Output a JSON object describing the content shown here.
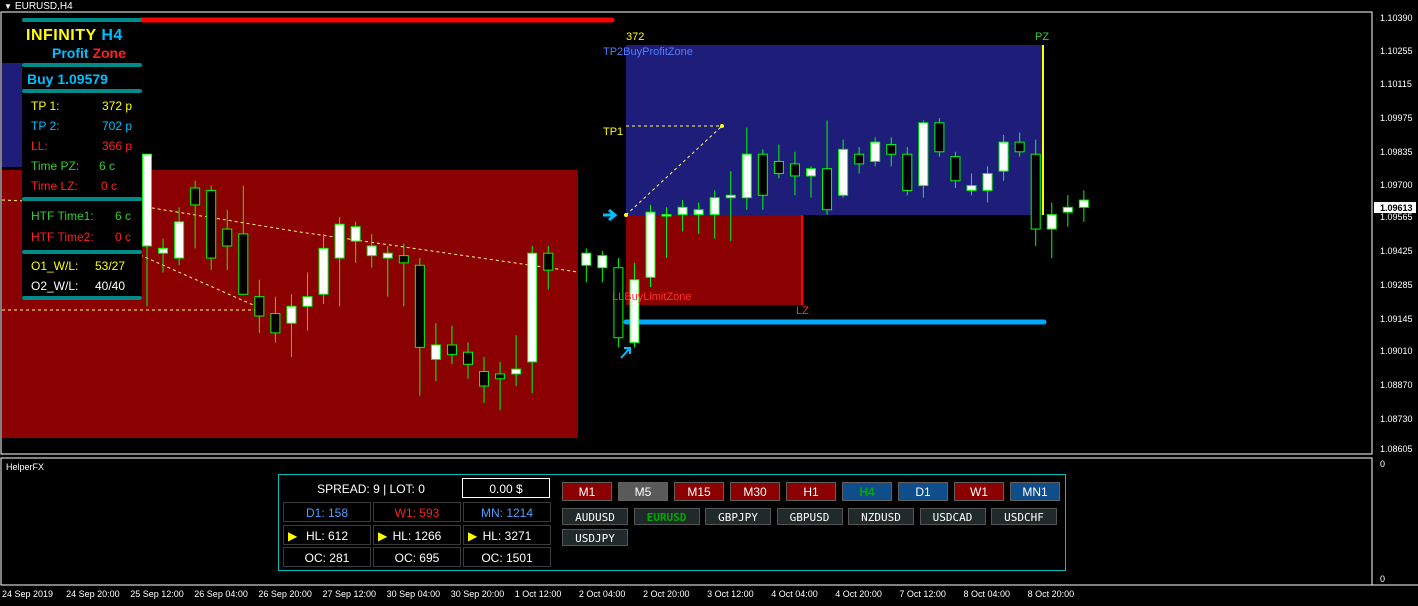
{
  "window": {
    "title": "EURUSD,H4"
  },
  "colors": {
    "bull_candle": "#ffffff",
    "candle_border": "#00ff00",
    "profit_zone": "#1e1e7a",
    "limit_zone": "#8b0000",
    "red_line": "#ff0000",
    "blue_line": "#00aaff"
  },
  "infinity_panel": {
    "logo_prefix": "INFINITY",
    "logo_timeframe": "H4",
    "logo_profit": "Profit",
    "logo_zone": "Zone",
    "signal": "Buy 1.09579",
    "rows": [
      {
        "label": "TP 1:",
        "value": "372 p",
        "color": "#ffff00"
      },
      {
        "label": "TP 2:",
        "value": "702 p",
        "color": "#00bfff"
      },
      {
        "label": "LL:",
        "value": "366 p",
        "color": "#ff2020"
      },
      {
        "label": "Time PZ:",
        "value": "6 c",
        "color": "#32cd32"
      },
      {
        "label": "Time LZ:",
        "value": "0 c",
        "color": "#ff2020"
      }
    ],
    "htf_rows": [
      {
        "label": "HTF Time1:",
        "value": "6 c",
        "color": "#32cd32"
      },
      {
        "label": "HTF Time2:",
        "value": "0 c",
        "color": "#ff2020"
      }
    ],
    "wl_rows": [
      {
        "label": "O1_W/L:",
        "value": "53/27",
        "color": "#ffff00"
      },
      {
        "label": "O2_W/L:",
        "value": "40/40",
        "color": "#ffffff"
      }
    ]
  },
  "annotations": {
    "tp1_label": "TP1",
    "tp1_points": "372",
    "tp2_zone": "TP2BuyProfitZone",
    "pz": "PZ",
    "ll_zone": "LLBuyLimitZone",
    "lz": "LZ"
  },
  "chart_data": {
    "type": "candlestick",
    "symbol": "EURUSD",
    "timeframe": "H4",
    "current_price": "1.09613",
    "y_ticks": [
      "1.10390",
      "1.10255",
      "1.10115",
      "1.09975",
      "1.09835",
      "1.09700",
      "1.09565",
      "1.09425",
      "1.09285",
      "1.09145",
      "1.09010",
      "1.08870",
      "1.08730",
      "1.08605"
    ],
    "ylim": [
      1.08605,
      1.1039
    ],
    "x_ticks": [
      "24 Sep 2019",
      "24 Sep 20:00",
      "25 Sep 12:00",
      "26 Sep 04:00",
      "26 Sep 20:00",
      "27 Sep 12:00",
      "30 Sep 04:00",
      "30 Sep 20:00",
      "1 Oct 12:00",
      "2 Oct 04:00",
      "2 Oct 20:00",
      "3 Oct 12:00",
      "4 Oct 04:00",
      "4 Oct 20:00",
      "7 Oct 12:00",
      "8 Oct 04:00",
      "8 Oct 20:00"
    ],
    "candles": [
      {
        "o": 1.0945,
        "h": 1.0982,
        "l": 1.092,
        "c": 1.0983
      },
      {
        "o": 1.0942,
        "h": 1.0948,
        "l": 1.0934,
        "c": 1.0944
      },
      {
        "o": 1.094,
        "h": 1.0961,
        "l": 1.0937,
        "c": 1.0955
      },
      {
        "o": 1.0969,
        "h": 1.0972,
        "l": 1.0944,
        "c": 1.0962
      },
      {
        "o": 1.0968,
        "h": 1.097,
        "l": 1.0935,
        "c": 1.094
      },
      {
        "o": 1.0952,
        "h": 1.096,
        "l": 1.0935,
        "c": 1.0945
      },
      {
        "o": 1.095,
        "h": 1.097,
        "l": 1.0927,
        "c": 1.0925
      },
      {
        "o": 1.0924,
        "h": 1.0931,
        "l": 1.0909,
        "c": 1.0916
      },
      {
        "o": 1.0917,
        "h": 1.0924,
        "l": 1.0905,
        "c": 1.0909
      },
      {
        "o": 1.0913,
        "h": 1.0925,
        "l": 1.0899,
        "c": 1.092
      },
      {
        "o": 1.092,
        "h": 1.0934,
        "l": 1.091,
        "c": 1.0924
      },
      {
        "o": 1.0925,
        "h": 1.095,
        "l": 1.0921,
        "c": 1.0944
      },
      {
        "o": 1.094,
        "h": 1.0957,
        "l": 1.092,
        "c": 1.0954
      },
      {
        "o": 1.0947,
        "h": 1.0955,
        "l": 1.0938,
        "c": 1.0953
      },
      {
        "o": 1.0941,
        "h": 1.095,
        "l": 1.0936,
        "c": 1.0945
      },
      {
        "o": 1.094,
        "h": 1.0945,
        "l": 1.0924,
        "c": 1.0942
      },
      {
        "o": 1.0941,
        "h": 1.0946,
        "l": 1.092,
        "c": 1.0938
      },
      {
        "o": 1.0937,
        "h": 1.094,
        "l": 1.0883,
        "c": 1.0903
      },
      {
        "o": 1.0898,
        "h": 1.0913,
        "l": 1.0889,
        "c": 1.0904
      },
      {
        "o": 1.0904,
        "h": 1.0912,
        "l": 1.0896,
        "c": 1.09
      },
      {
        "o": 1.0901,
        "h": 1.0905,
        "l": 1.089,
        "c": 1.0896
      },
      {
        "o": 1.0893,
        "h": 1.0899,
        "l": 1.088,
        "c": 1.0887
      },
      {
        "o": 1.0892,
        "h": 1.0897,
        "l": 1.0877,
        "c": 1.089
      },
      {
        "o": 1.0892,
        "h": 1.0908,
        "l": 1.0887,
        "c": 1.0894
      },
      {
        "o": 1.0897,
        "h": 1.0945,
        "l": 1.0884,
        "c": 1.0942
      },
      {
        "o": 1.0942,
        "h": 1.0945,
        "l": 1.0927,
        "c": 1.0935
      },
      {
        "o": 1.0937,
        "h": 1.0944,
        "l": 1.093,
        "c": 1.0942
      },
      {
        "o": 1.0936,
        "h": 1.0943,
        "l": 1.093,
        "c": 1.0941
      },
      {
        "o": 1.0936,
        "h": 1.094,
        "l": 1.0903,
        "c": 1.0907
      },
      {
        "o": 1.0905,
        "h": 1.0938,
        "l": 1.0903,
        "c": 1.0931
      },
      {
        "o": 1.0932,
        "h": 1.0962,
        "l": 1.0928,
        "c": 1.0959
      },
      {
        "o": 1.0958,
        "h": 1.0961,
        "l": 1.094,
        "c": 1.0958
      },
      {
        "o": 1.0958,
        "h": 1.0964,
        "l": 1.0951,
        "c": 1.0961
      },
      {
        "o": 1.0958,
        "h": 1.0963,
        "l": 1.095,
        "c": 1.096
      },
      {
        "o": 1.0958,
        "h": 1.0968,
        "l": 1.0948,
        "c": 1.0965
      },
      {
        "o": 1.0965,
        "h": 1.0976,
        "l": 1.0947,
        "c": 1.0966
      },
      {
        "o": 1.0965,
        "h": 1.0994,
        "l": 1.096,
        "c": 1.0983
      },
      {
        "o": 1.0983,
        "h": 1.0985,
        "l": 1.096,
        "c": 1.0966
      },
      {
        "o": 1.098,
        "h": 1.0987,
        "l": 1.0973,
        "c": 1.0975
      },
      {
        "o": 1.0979,
        "h": 1.0984,
        "l": 1.0966,
        "c": 1.0974
      },
      {
        "o": 1.0974,
        "h": 1.0978,
        "l": 1.0965,
        "c": 1.0977
      },
      {
        "o": 1.0977,
        "h": 1.0997,
        "l": 1.0958,
        "c": 1.096
      },
      {
        "o": 1.0966,
        "h": 1.0989,
        "l": 1.0965,
        "c": 1.0985
      },
      {
        "o": 1.0983,
        "h": 1.0986,
        "l": 1.0975,
        "c": 1.0979
      },
      {
        "o": 1.098,
        "h": 1.099,
        "l": 1.0978,
        "c": 1.0988
      },
      {
        "o": 1.0987,
        "h": 1.099,
        "l": 1.0978,
        "c": 1.0983
      },
      {
        "o": 1.0983,
        "h": 1.0986,
        "l": 1.0966,
        "c": 1.0968
      },
      {
        "o": 1.097,
        "h": 1.0997,
        "l": 1.0965,
        "c": 1.0996
      },
      {
        "o": 1.0996,
        "h": 1.0998,
        "l": 1.0982,
        "c": 1.0984
      },
      {
        "o": 1.0982,
        "h": 1.0984,
        "l": 1.0969,
        "c": 1.0972
      },
      {
        "o": 1.0968,
        "h": 1.0975,
        "l": 1.0966,
        "c": 1.097
      },
      {
        "o": 1.0968,
        "h": 1.0978,
        "l": 1.0963,
        "c": 1.0975
      },
      {
        "o": 1.0976,
        "h": 1.0991,
        "l": 1.0972,
        "c": 1.0988
      },
      {
        "o": 1.0988,
        "h": 1.0992,
        "l": 1.0982,
        "c": 1.0984
      },
      {
        "o": 1.0983,
        "h": 1.0989,
        "l": 1.0945,
        "c": 1.0952
      },
      {
        "o": 1.0952,
        "h": 1.0963,
        "l": 1.094,
        "c": 1.0958
      },
      {
        "o": 1.0959,
        "h": 1.0966,
        "l": 1.0953,
        "c": 1.0961
      },
      {
        "o": 1.0961,
        "h": 1.0968,
        "l": 1.0955,
        "c": 1.0964
      }
    ]
  },
  "helperfx": {
    "title": "HelperFX",
    "spread_lot": "SPREAD: 9  |  LOT: 0",
    "pnl": "0.00 $",
    "d1": "D1: 158",
    "w1": "W1: 593",
    "mn": "MN: 1214",
    "hl": [
      "HL: 612",
      "HL: 1266",
      "HL: 3271"
    ],
    "oc": [
      "OC: 281",
      "OC: 695",
      "OC: 1501"
    ],
    "timeframes": [
      {
        "label": "M1",
        "bg": "#8b0000",
        "fg": "#ffffff"
      },
      {
        "label": "M5",
        "bg": "#5a5a5a",
        "fg": "#ffffff"
      },
      {
        "label": "M15",
        "bg": "#8b0000",
        "fg": "#ffffff"
      },
      {
        "label": "M30",
        "bg": "#8b0000",
        "fg": "#ffffff"
      },
      {
        "label": "H1",
        "bg": "#8b0000",
        "fg": "#ffffff"
      },
      {
        "label": "H4",
        "bg": "#104e8b",
        "fg": "#00aa00"
      },
      {
        "label": "D1",
        "bg": "#104e8b",
        "fg": "#ffffff"
      },
      {
        "label": "W1",
        "bg": "#8b0000",
        "fg": "#ffffff"
      },
      {
        "label": "MN1",
        "bg": "#104e8b",
        "fg": "#ffffff"
      }
    ],
    "symbols": [
      {
        "label": "AUDUSD",
        "active": false
      },
      {
        "label": "EURUSD",
        "active": true
      },
      {
        "label": "GBPJPY",
        "active": false
      },
      {
        "label": "GBPUSD",
        "active": false
      },
      {
        "label": "NZDUSD",
        "active": false
      },
      {
        "label": "USDCAD",
        "active": false
      },
      {
        "label": "USDCHF",
        "active": false
      },
      {
        "label": "USDJPY",
        "active": false
      }
    ],
    "subwindow_y_ticks": [
      "0",
      "0"
    ]
  }
}
